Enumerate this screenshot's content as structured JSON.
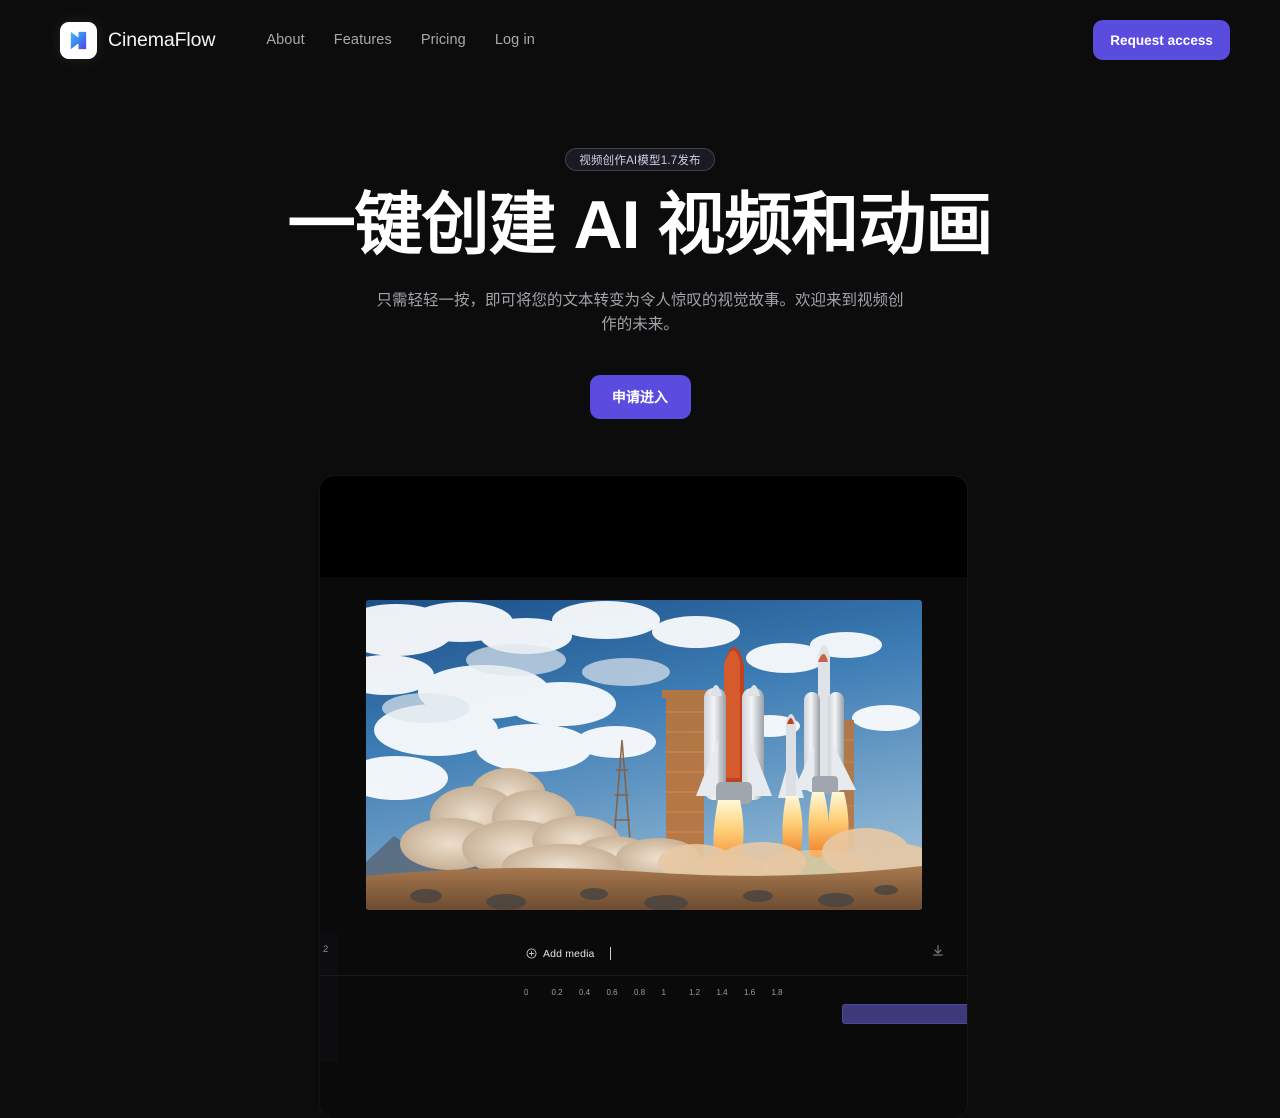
{
  "brand": {
    "name": "CinemaFlow",
    "logo_icon": "cinemaflow-bowtie-logo",
    "logo_gradient_from": "#3fa9f5",
    "logo_gradient_to": "#5b4ce0"
  },
  "header": {
    "nav": [
      {
        "label": "About"
      },
      {
        "label": "Features"
      },
      {
        "label": "Pricing"
      },
      {
        "label": "Log in"
      }
    ],
    "cta_label": "Request access",
    "cta_color": "#5b4ce0"
  },
  "hero": {
    "badge": "视频创作AI模型1.7发布",
    "title": "一键创建 AI 视频和动画",
    "subtitle": "只需轻轻一按，即可将您的文本转变为令人惊叹的视觉故事。欢迎来到视频创作的未来。",
    "cta_label": "申请进入",
    "cta_color": "#5b4ce0"
  },
  "mockup": {
    "track_number": "2",
    "add_media_label": "Add media",
    "add_media_icon": "plus-circle-icon",
    "export_icon": "download-icon",
    "timeline_ticks": [
      "0",
      "0.2",
      "0.4",
      "0.6",
      "0.8",
      "1",
      "1.2",
      "1.4",
      "1.6",
      "1.8"
    ],
    "clip_color": "#3e3a7a",
    "preview_alt": "rocket-launch-scene"
  },
  "theme": {
    "page_background": "#0c0c0d",
    "text_primary": "#ffffff",
    "text_muted": "#a2a2a9",
    "accent": "#5b4ce0"
  }
}
